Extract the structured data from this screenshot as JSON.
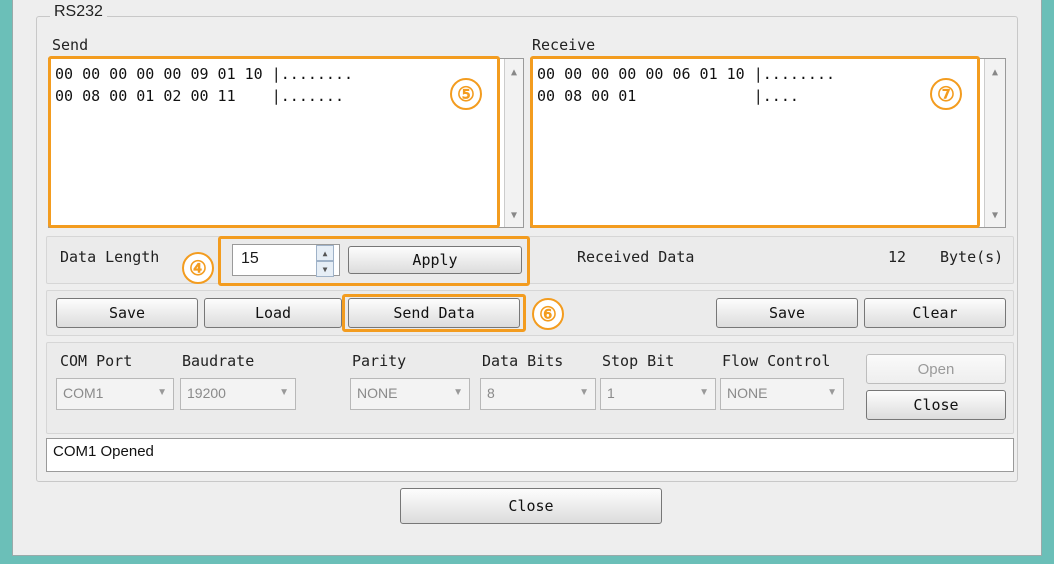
{
  "group_title": "RS232",
  "send": {
    "label": "Send",
    "lines": "00 00 00 00 00 09 01 10 |........\n00 08 00 01 02 00 11    |.......",
    "badge": "⑤",
    "scroll_up": "▲",
    "scroll_down": "▼"
  },
  "receive": {
    "label": "Receive",
    "lines": "00 00 00 00 00 06 01 10 |........\n00 08 00 01             |....",
    "badge": "⑦",
    "scroll_up": "▲",
    "scroll_down": "▼"
  },
  "data_length": {
    "label": "Data Length",
    "value": "15",
    "badge": "④",
    "apply_label": "Apply",
    "spin_up": "▲",
    "spin_down": "▼"
  },
  "received_data": {
    "label": "Received Data",
    "count": "12",
    "unit": "Byte(s)"
  },
  "actions": {
    "save_send": "Save",
    "load": "Load",
    "send_data": "Send Data",
    "badge": "⑥",
    "save_receive": "Save",
    "clear": "Clear"
  },
  "settings": {
    "com_port": {
      "label": "COM Port",
      "value": "COM1"
    },
    "baudrate": {
      "label": "Baudrate",
      "value": "19200"
    },
    "parity": {
      "label": "Parity",
      "value": "NONE"
    },
    "data_bits": {
      "label": "Data Bits",
      "value": "8"
    },
    "stop_bit": {
      "label": "Stop Bit",
      "value": "1"
    },
    "flow_control": {
      "label": "Flow Control",
      "value": "NONE"
    },
    "dropdown_icon": "▼",
    "open_label": "Open",
    "close_port_label": "Close"
  },
  "status": "COM1 Opened",
  "close_label": "Close",
  "colors": {
    "accent_orange": "#f39c1f",
    "frame_teal": "#6bbfb8"
  }
}
